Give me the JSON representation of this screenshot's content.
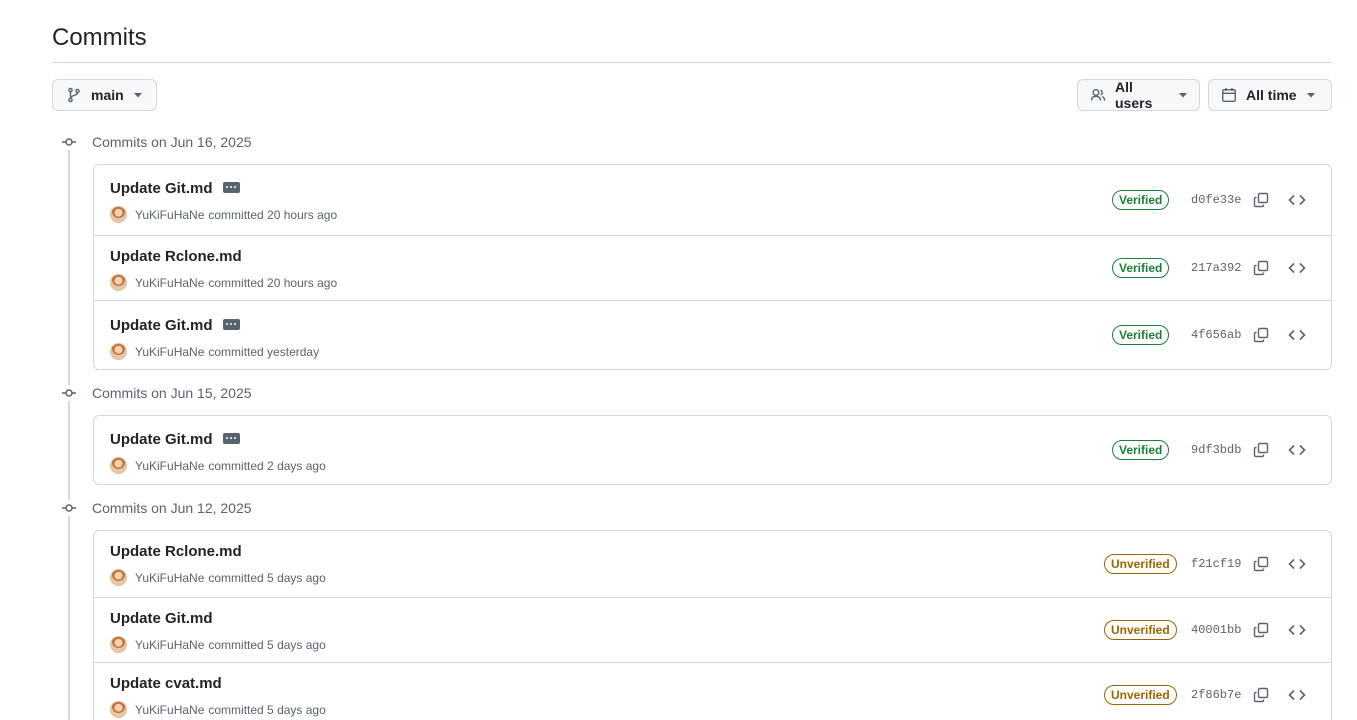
{
  "page": {
    "title": "Commits"
  },
  "filters": {
    "branch_label": "main",
    "users_label": "All users",
    "time_label": "All time"
  },
  "groups": [
    {
      "heading": "Commits on Jun 16, 2025",
      "commits": [
        {
          "message": "Update Git.md",
          "has_description": true,
          "author": "YuKiFuHaNe",
          "action": "committed 20 hours ago",
          "status": "Verified",
          "sha": "d0fe33e"
        },
        {
          "message": "Update Rclone.md",
          "has_description": false,
          "author": "YuKiFuHaNe",
          "action": "committed 20 hours ago",
          "status": "Verified",
          "sha": "217a392"
        },
        {
          "message": "Update Git.md",
          "has_description": true,
          "author": "YuKiFuHaNe",
          "action": "committed yesterday",
          "status": "Verified",
          "sha": "4f656ab"
        }
      ]
    },
    {
      "heading": "Commits on Jun 15, 2025",
      "commits": [
        {
          "message": "Update Git.md",
          "has_description": true,
          "author": "YuKiFuHaNe",
          "action": "committed 2 days ago",
          "status": "Verified",
          "sha": "9df3bdb"
        }
      ]
    },
    {
      "heading": "Commits on Jun 12, 2025",
      "commits": [
        {
          "message": "Update Rclone.md",
          "has_description": false,
          "author": "YuKiFuHaNe",
          "action": "committed 5 days ago",
          "status": "Unverified",
          "sha": "f21cf19"
        },
        {
          "message": "Update Git.md",
          "has_description": false,
          "author": "YuKiFuHaNe",
          "action": "committed 5 days ago",
          "status": "Unverified",
          "sha": "40001bb"
        },
        {
          "message": "Update cvat.md",
          "has_description": false,
          "author": "YuKiFuHaNe",
          "action": "committed 5 days ago",
          "status": "Unverified",
          "sha": "2f86b7e"
        }
      ]
    }
  ],
  "colors": {
    "verified": "#1a7f37",
    "unverified": "#9a6700",
    "border": "#d1d9e0",
    "muted": "#59636e"
  },
  "icons": [
    "git-branch-icon",
    "people-icon",
    "calendar-icon",
    "triangle-down-icon",
    "git-commit-icon",
    "kebab-horizontal-icon",
    "copy-icon",
    "code-icon",
    "avatar"
  ]
}
